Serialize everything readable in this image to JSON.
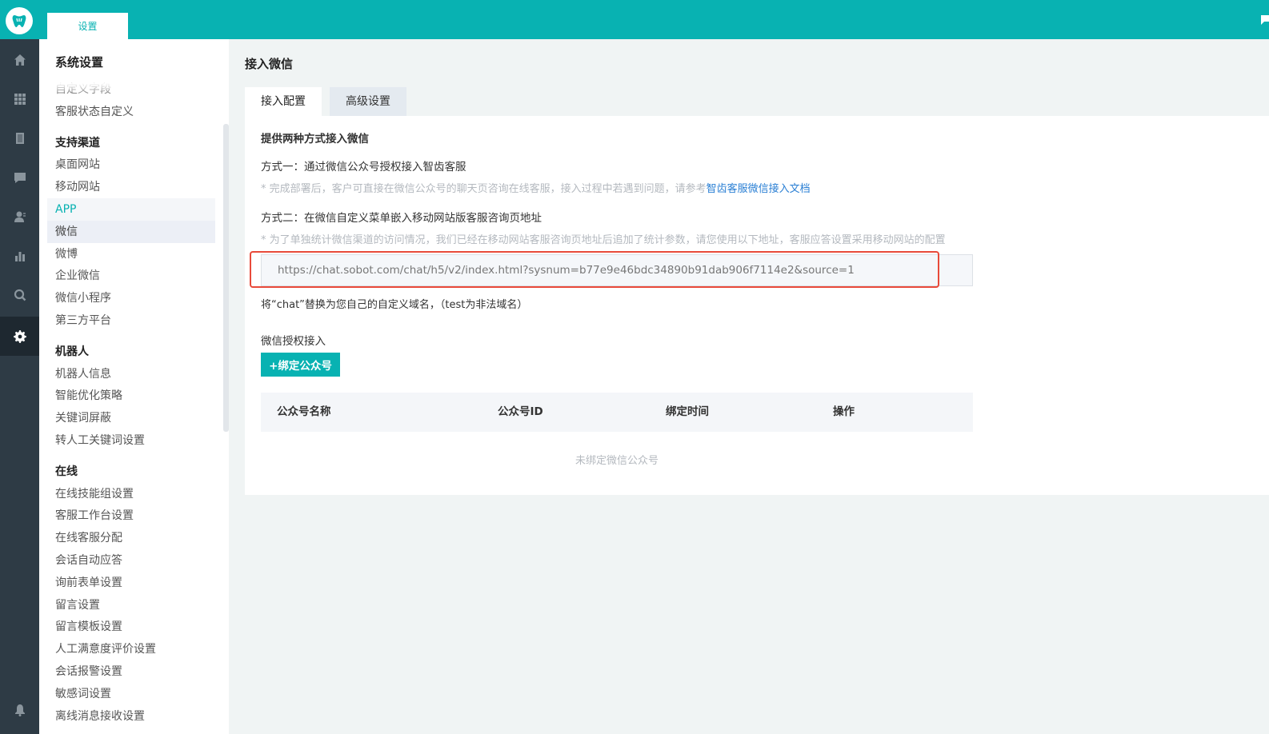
{
  "topbar": {
    "tab_label": "设置"
  },
  "sidebar": {
    "title": "系统设置",
    "items": [
      {
        "label": "自定义字段",
        "kind": "item"
      },
      {
        "label": "客服状态自定义",
        "kind": "item"
      },
      {
        "label": "支持渠道",
        "kind": "group"
      },
      {
        "label": "桌面网站",
        "kind": "item"
      },
      {
        "label": "移动网站",
        "kind": "item"
      },
      {
        "label": "APP",
        "kind": "item"
      },
      {
        "label": "微信",
        "kind": "item"
      },
      {
        "label": "微博",
        "kind": "item"
      },
      {
        "label": "企业微信",
        "kind": "item"
      },
      {
        "label": "微信小程序",
        "kind": "item"
      },
      {
        "label": "第三方平台",
        "kind": "item"
      },
      {
        "label": "机器人",
        "kind": "group"
      },
      {
        "label": "机器人信息",
        "kind": "item"
      },
      {
        "label": "智能优化策略",
        "kind": "item"
      },
      {
        "label": "关键词屏蔽",
        "kind": "item"
      },
      {
        "label": "转人工关键词设置",
        "kind": "item"
      },
      {
        "label": "在线",
        "kind": "group"
      },
      {
        "label": "在线技能组设置",
        "kind": "item"
      },
      {
        "label": "客服工作台设置",
        "kind": "item"
      },
      {
        "label": "在线客服分配",
        "kind": "item"
      },
      {
        "label": "会话自动应答",
        "kind": "item"
      },
      {
        "label": "询前表单设置",
        "kind": "item"
      },
      {
        "label": "留言设置",
        "kind": "item"
      },
      {
        "label": "留言模板设置",
        "kind": "item"
      },
      {
        "label": "人工满意度评价设置",
        "kind": "item"
      },
      {
        "label": "会话报警设置",
        "kind": "item"
      },
      {
        "label": "敏感词设置",
        "kind": "item"
      },
      {
        "label": "离线消息接收设置",
        "kind": "item"
      }
    ]
  },
  "main": {
    "page_title": "接入微信",
    "tabs": [
      {
        "label": "接入配置"
      },
      {
        "label": "高级设置"
      }
    ],
    "intro": "提供两种方式接入微信",
    "method1": {
      "title": "方式一：通过微信公众号授权接入智齿客服",
      "hint": "* 完成部署后，客户可直接在微信公众号的聊天页咨询在线客服，接入过程中若遇到问题，请参考",
      "link": "智齿客服微信接入文档"
    },
    "method2": {
      "title": "方式二：在微信自定义菜单嵌入移动网站版客服咨询页地址",
      "hint": "* 为了单独统计微信渠道的访问情况，我们已经在移动网站客服咨询页地址后追加了统计参数，请您使用以下地址，客服应答设置采用移动网站的配置",
      "url": "https://chat.sobot.com/chat/h5/v2/index.html?sysnum=b77e9e46bdc34890b91dab906f7114e2&source=1",
      "note": "将“chat”替换为您自己的自定义域名，（test为非法域名）"
    },
    "auth": {
      "title": "微信授权接入",
      "bind_button": "+绑定公众号",
      "columns": [
        "公众号名称",
        "公众号ID",
        "绑定时间",
        "操作"
      ],
      "empty_text": "未绑定微信公众号"
    }
  },
  "colors": {
    "accent": "#08b2b2",
    "nav_bg": "#2e3b45",
    "highlight_border": "#e84a3a",
    "link": "#2a7fd4"
  },
  "icons": [
    "tooth-logo-icon",
    "home-icon",
    "apps-icon",
    "book-icon",
    "chat-icon",
    "user-icon",
    "chart-icon",
    "search-icon",
    "gear-icon",
    "bell-icon",
    "flag-icon"
  ]
}
